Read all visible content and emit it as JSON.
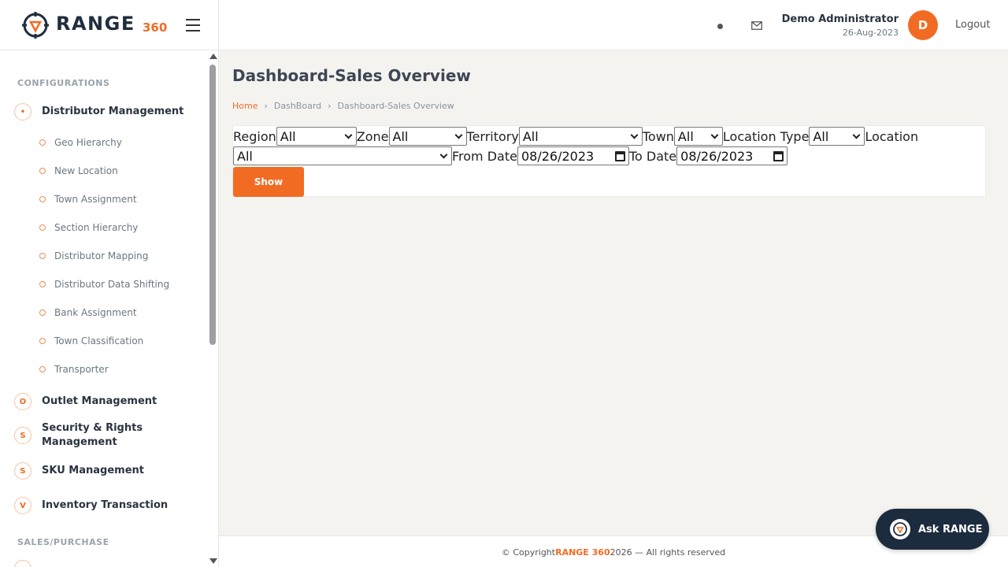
{
  "brand": {
    "name": "RANGE",
    "suffix": "360"
  },
  "header": {
    "user_name": "Demo Administrator",
    "user_date": "26-Aug-2023",
    "avatar_initial": "D",
    "logout_label": "Logout",
    "icons": [
      "notification-dot-icon",
      "mail-icon"
    ]
  },
  "sidebar": {
    "section_configurations": "CONFIGURATIONS",
    "distributor_management": {
      "badge": "•",
      "label": "Distributor Management"
    },
    "sub_items": [
      "Geo Hierarchy",
      "New Location",
      "Town Assignment",
      "Section Hierarchy",
      "Distributor Mapping",
      "Distributor Data Shifting",
      "Bank Assignment",
      "Town Classification",
      "Transporter"
    ],
    "groups": [
      {
        "badge": "O",
        "label": "Outlet Management"
      },
      {
        "badge": "S",
        "label": "Security & Rights Management"
      },
      {
        "badge": "S",
        "label": "SKU Management"
      },
      {
        "badge": "V",
        "label": "Inventory Transaction"
      }
    ],
    "section_sales": "SALES/PURCHASE"
  },
  "page": {
    "title": "Dashboard-Sales Overview",
    "breadcrumb": [
      "Home",
      "DashBoard",
      "Dashboard-Sales Overview"
    ],
    "breadcrumb_sep": "›"
  },
  "filters": {
    "region_label": "Region",
    "region_value": "All",
    "zone_label": "Zone",
    "zone_value": "All",
    "territory_label": "Territory",
    "territory_value": "All",
    "town_label": "Town",
    "town_value": "All",
    "location_type_label": "Location Type",
    "location_type_value": "All",
    "location_label": "Location",
    "location_value": "All",
    "from_date_label": "From Date",
    "from_date_value": "08/26/2023",
    "to_date_label": "To Date",
    "to_date_value": "08/26/2023",
    "show_label": "Show"
  },
  "footer": {
    "prefix": "© Copyright",
    "brand": "RANGE 360",
    "suffix": "2026 — All rights reserved"
  },
  "assistant": {
    "label": "Ask RANGE"
  },
  "colors": {
    "accent": "#f26b23",
    "dark": "#1c2b3d"
  }
}
